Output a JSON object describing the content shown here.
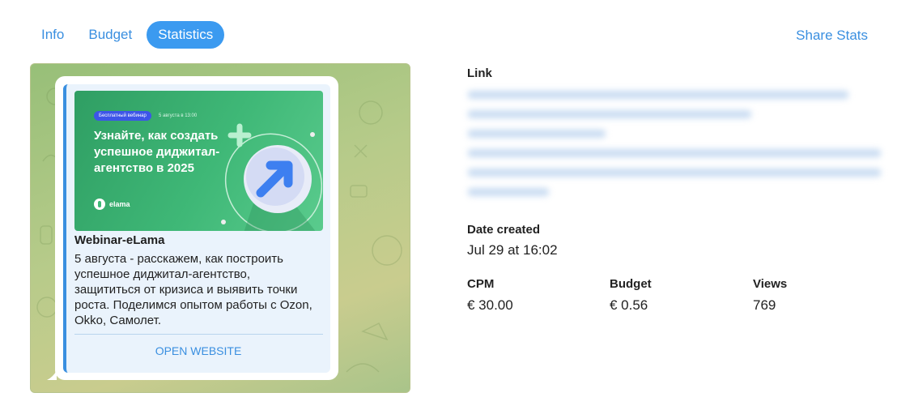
{
  "tabs": [
    {
      "label": "Info"
    },
    {
      "label": "Budget"
    },
    {
      "label": "Statistics"
    }
  ],
  "share_label": "Share Stats",
  "preview": {
    "banner": {
      "pill": "Бесплатный вебинар",
      "date": "5 августа в 13:00",
      "title": "Узнайте, как создать успешное диджитал-агентство в 2025",
      "brand": "elama"
    },
    "title": "Webinar-eLama",
    "text": "5 августа - расскажем, как построить успешное диджитал-агентство, защититься от кризиса и выявить точки роста. Поделимся опытом работы с Ozon, Okko, Самолет.",
    "action": "OPEN WEBSITE"
  },
  "details": {
    "link_label": "Link",
    "date_label": "Date created",
    "date_value": "Jul 29 at 16:02",
    "cpm_label": "CPM",
    "cpm_value": "€ 30.00",
    "budget_label": "Budget",
    "budget_value": "€ 0.56",
    "views_label": "Views",
    "views_value": "769"
  },
  "colors": {
    "accent": "#3b9af0",
    "banner_green": "#3fb877",
    "pill_blue": "#3d55e8"
  }
}
